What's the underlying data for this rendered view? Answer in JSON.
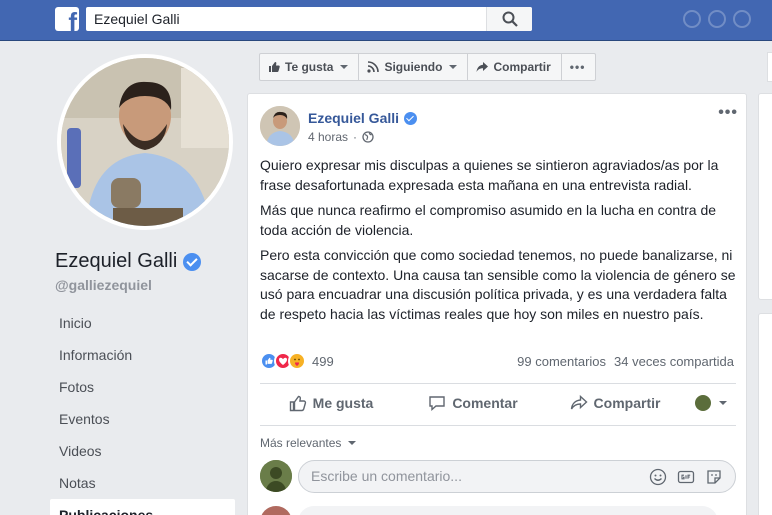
{
  "topbar": {
    "logo": "f",
    "search_value": "Ezequiel Galli",
    "search_icon": "search-icon"
  },
  "profile": {
    "name": "Ezequiel Galli",
    "handle": "@galliezequiel",
    "verified": true
  },
  "nav": {
    "items": [
      "Inicio",
      "Información",
      "Fotos",
      "Eventos",
      "Videos",
      "Notas",
      "Publicaciones"
    ],
    "active_index": 6
  },
  "actionbar": {
    "like_label": "Te gusta",
    "following_label": "Siguiendo",
    "share_label": "Compartir",
    "more_label": "•••"
  },
  "post": {
    "author": "Ezequiel Galli",
    "time": "4 horas",
    "menu": "•••",
    "paragraphs": [
      "Quiero expresar mis disculpas a quienes se sintieron agraviados/as por la frase desafortunada expresada esta mañana en una entrevista radial.",
      "Más que nunca reafirmo el compromiso asumido en la lucha en contra de toda acción de violencia.",
      "Pero esta convicción que como sociedad tenemos, no puede banalizarse, ni sacarse de contexto. Una causa tan sensible como la violencia de género se usó para encuadrar una discusión política privada, y es una verdadera falta de respeto hacia las víctimas reales que hoy son miles en nuestro país."
    ],
    "reaction_count": "499",
    "comments_count": "99 comentarios",
    "shares_count": "34 veces compartida",
    "actions": {
      "like": "Me gusta",
      "comment": "Comentar",
      "share": "Compartir"
    },
    "sort_label": "Más relevantes",
    "comment_placeholder": "Escribe un comentario..."
  },
  "colors": {
    "topbar": "#4267b2",
    "link": "#365899",
    "background": "#e9ebee"
  }
}
